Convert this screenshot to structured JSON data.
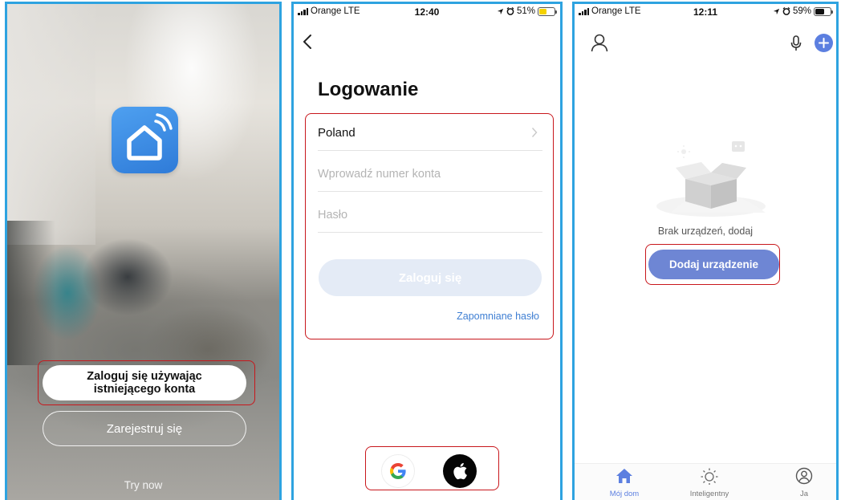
{
  "screen1": {
    "login_existing_label": "Zaloguj się używając istniejącego konta",
    "register_label": "Zarejestruj się",
    "try_now_label": "Try now",
    "logo_icon": "smart-home-wifi-icon"
  },
  "screen2": {
    "status": {
      "carrier": "Orange",
      "network": "LTE",
      "time": "12:40",
      "battery": "51%",
      "battery_level": 0.51,
      "charging": true
    },
    "title": "Logowanie",
    "country": "Poland",
    "account_placeholder": "Wprowadź numer konta",
    "password_placeholder": "Hasło",
    "login_button": "Zaloguj się",
    "forgot_password": "Zapomniane hasło",
    "social": [
      "google-icon",
      "apple-icon"
    ]
  },
  "screen3": {
    "status": {
      "carrier": "Orange",
      "network": "LTE",
      "time": "12:11",
      "battery": "59%",
      "battery_level": 0.59,
      "charging": false
    },
    "empty_text": "Brak urządzeń, dodaj",
    "add_device_button": "Dodaj urządzenie",
    "tabs": [
      {
        "label": "Mój dom",
        "icon": "home-icon",
        "active": true
      },
      {
        "label": "Inteligentny",
        "icon": "sun-icon",
        "active": false
      },
      {
        "label": "Ja",
        "icon": "profile-icon",
        "active": false
      }
    ]
  },
  "colors": {
    "frame_border": "#2ea3e0",
    "highlight": "#c8171c",
    "accent_blue": "#3f7fd3",
    "add_button": "#6e86d4",
    "login_disabled": "#e4ebf6"
  }
}
